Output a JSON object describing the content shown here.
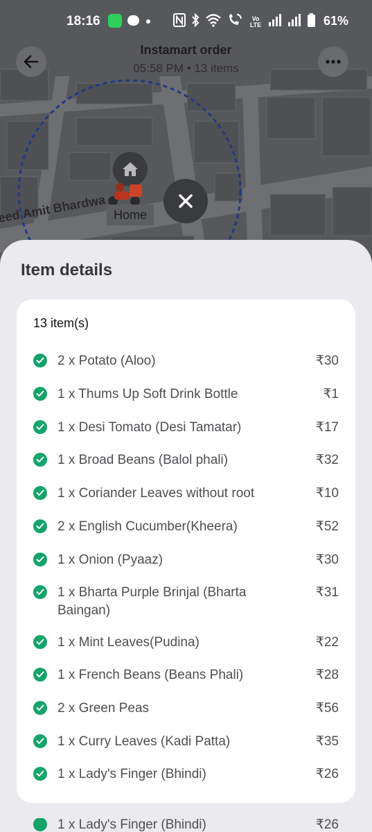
{
  "status_bar": {
    "time": "18:16",
    "battery": "61%",
    "network_label": "Vo LTE"
  },
  "header": {
    "title": "Instamart order",
    "subtitle": "05:58 PM • 13 items"
  },
  "map": {
    "road_label": "eed Amit Bhardwa",
    "home_label": "Home"
  },
  "sheet": {
    "title": "Item details",
    "count": "13 item(s)",
    "items": [
      {
        "name": "2 x Potato (Aloo)",
        "price": "₹30"
      },
      {
        "name": "1 x Thums Up Soft Drink Bottle",
        "price": "₹1"
      },
      {
        "name": "1 x Desi Tomato (Desi Tamatar)",
        "price": "₹17"
      },
      {
        "name": "1 x Broad Beans (Balol phali)",
        "price": "₹32"
      },
      {
        "name": "1 x Coriander Leaves without root",
        "price": "₹10"
      },
      {
        "name": "2 x English Cucumber(Kheera)",
        "price": "₹52"
      },
      {
        "name": "1 x Onion (Pyaaz)",
        "price": "₹30"
      },
      {
        "name": "1 x Bharta Purple Brinjal (Bharta Baingan)",
        "price": "₹31"
      },
      {
        "name": "1 x Mint Leaves(Pudina)",
        "price": "₹22"
      },
      {
        "name": "1 x French Beans (Beans Phali)",
        "price": "₹28"
      },
      {
        "name": "2 x Green Peas",
        "price": "₹56"
      },
      {
        "name": "1 x Curry Leaves (Kadi Patta)",
        "price": "₹35"
      },
      {
        "name": "1 x Lady's Finger (Bhindi)",
        "price": "₹26"
      }
    ],
    "peek_item": {
      "name": "1 x Lady's Finger (Bhindi)",
      "price": "₹26"
    }
  },
  "colors": {
    "accent_check": "#13a36b",
    "map_bg": "#57585b"
  }
}
